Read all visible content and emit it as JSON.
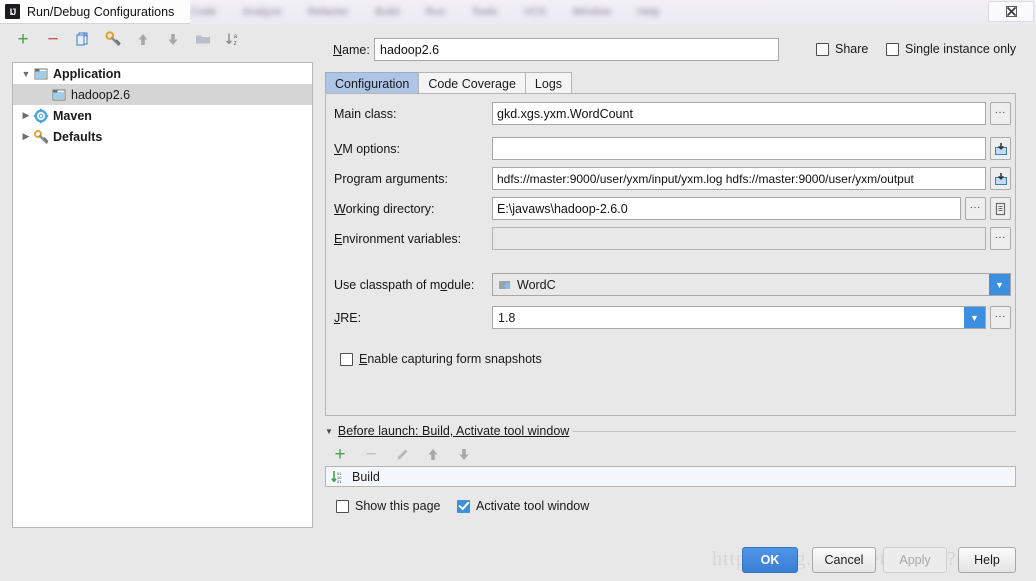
{
  "window": {
    "title": "Run/Debug Configurations",
    "app_icon": "intellij-idea-icon",
    "close_label": "✖"
  },
  "background_menubar": {
    "items": [
      "Code",
      "Analyze",
      "Refactor",
      "Build",
      "Run",
      "Tools",
      "VCS",
      "Window",
      "Help"
    ]
  },
  "toolbar": {
    "buttons": [
      {
        "name": "add",
        "glyph": "+"
      },
      {
        "name": "remove",
        "glyph": "–"
      },
      {
        "name": "copy",
        "glyph": "❐"
      },
      {
        "name": "edit-defaults",
        "glyph": "⚒"
      },
      {
        "name": "move-up",
        "glyph": "↑"
      },
      {
        "name": "move-down",
        "glyph": "↓"
      },
      {
        "name": "new-folder",
        "glyph": "▬"
      },
      {
        "name": "sort-alphabetically",
        "glyph": "↓"
      }
    ]
  },
  "tree": {
    "nodes": [
      {
        "label": "Application",
        "expander": "▼",
        "icon": "application-icon",
        "bold": true,
        "indent": 4,
        "selected": false
      },
      {
        "label": "hadoop2.6",
        "expander": "",
        "icon": "application-icon",
        "bold": false,
        "indent": 36,
        "selected": true
      },
      {
        "label": "Maven",
        "expander": "▶",
        "icon": "maven-icon",
        "bold": true,
        "indent": 4,
        "selected": false
      },
      {
        "label": "Defaults",
        "expander": "▶",
        "icon": "defaults-icon",
        "bold": true,
        "indent": 4,
        "selected": false
      }
    ]
  },
  "header": {
    "name_label": "Name:",
    "name_value": "hadoop2.6",
    "share_label": "Share",
    "share_checked": false,
    "single_instance_label": "Single instance only",
    "single_instance_checked": false
  },
  "tabs": [
    {
      "label": "Configuration",
      "active": true
    },
    {
      "label": "Code Coverage",
      "active": false
    },
    {
      "label": "Logs",
      "active": false
    }
  ],
  "configuration": {
    "main_class": {
      "label": "Main class:",
      "value": "gkd.xgs.yxm.WordCount",
      "button": "..."
    },
    "vm_options": {
      "label": "VM options:",
      "value": "",
      "button": "expand-icon"
    },
    "program_arguments": {
      "label": "Program arguments:",
      "value": "hdfs://master:9000/user/yxm/input/yxm.log hdfs://master:9000/user/yxm/output",
      "button": "expand-icon"
    },
    "working_directory": {
      "label": "Working directory:",
      "value": "E:\\javaws\\hadoop-2.6.0",
      "button": "...",
      "button2": "macro-icon"
    },
    "environment_variables": {
      "label": "Environment variables:",
      "value": "",
      "button": "..."
    },
    "classpath_module": {
      "label": "Use classpath of m̲odule:",
      "value": "WordC",
      "icon": "module-icon"
    },
    "jre": {
      "label": "JRE:",
      "value": "1.8",
      "button": "..."
    },
    "form_snapshots": {
      "label": "Enable capturing form snapshots",
      "checked": false
    }
  },
  "before_launch": {
    "header": "Before launch: Build, Activate tool window",
    "toolbar": [
      {
        "name": "add-task",
        "glyph": "+"
      },
      {
        "name": "remove-task",
        "glyph": "–"
      },
      {
        "name": "edit-task",
        "glyph": "✎"
      },
      {
        "name": "move-task-up",
        "glyph": "↑"
      },
      {
        "name": "move-task-down",
        "glyph": "↓"
      }
    ],
    "tasks": [
      {
        "label": "Build",
        "icon": "build-icon"
      }
    ],
    "show_page": {
      "label": "Show this page",
      "checked": false
    },
    "activate_tool_window": {
      "label": "Activate tool window",
      "checked": true
    }
  },
  "footer": {
    "ok": "OK",
    "cancel": "Cancel",
    "apply": "Apply",
    "help": "Help",
    "watermark": "http://blog.csdn.net/u01?6?63?"
  }
}
